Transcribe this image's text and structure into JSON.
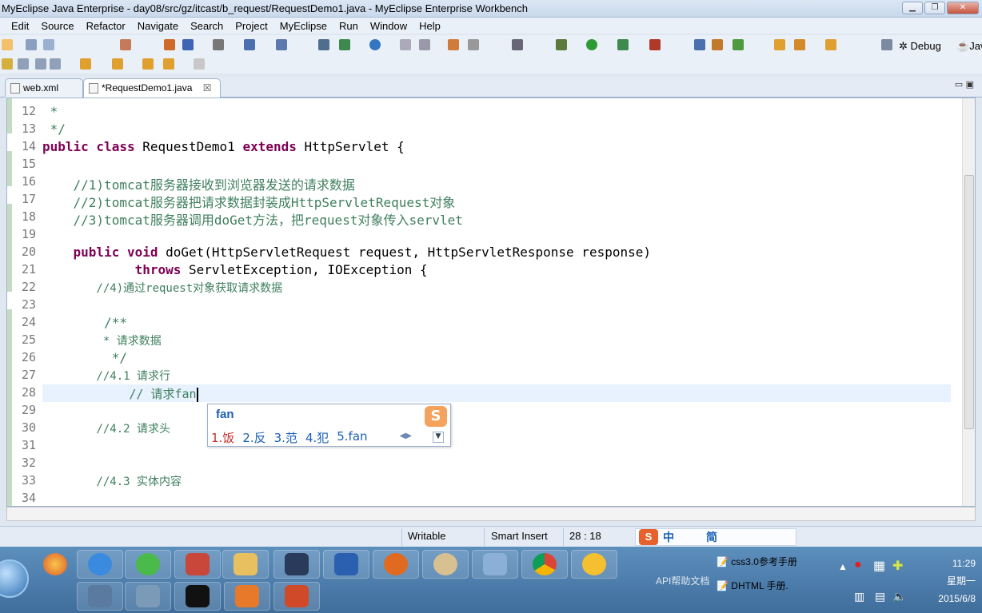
{
  "window": {
    "title": "MyEclipse Java Enterprise - day08/src/gz/itcast/b_request/RequestDemo1.java - MyEclipse Enterprise Workbench"
  },
  "menu": [
    "Edit",
    "Source",
    "Refactor",
    "Navigate",
    "Search",
    "Project",
    "MyEclipse",
    "Run",
    "Window",
    "Help"
  ],
  "perspectives": {
    "debug": "Debug",
    "java": "Jav"
  },
  "tabs": [
    {
      "label": "web.xml",
      "active": false
    },
    {
      "label": "*RequestDemo1.java",
      "active": true,
      "close": "☒"
    }
  ],
  "editor": {
    "lines": [
      {
        "n": "12",
        "text": " *"
      },
      {
        "n": "13",
        "text": " */"
      },
      {
        "n": "14",
        "pre": "",
        "kw1": "public class",
        "mid": " RequestDemo1 ",
        "kw2": "extends",
        "post": " HttpServlet {"
      },
      {
        "n": "15",
        "text": ""
      },
      {
        "n": "16",
        "comment": "    //1)tomcat服务器接收到浏览器发送的请求数据"
      },
      {
        "n": "17",
        "comment": "    //2)tomcat服务器把请求数据封装成HttpServletRequest对象"
      },
      {
        "n": "18",
        "comment": "    //3)tomcat服务器调用doGet方法，把request对象传入servlet"
      },
      {
        "n": "19",
        "text": ""
      },
      {
        "n": "20",
        "kw1": "    public void",
        "post": " doGet(HttpServletRequest request, HttpServletResponse response)"
      },
      {
        "n": "21",
        "kw1": "            throws",
        "post": " ServletException, IOException {"
      },
      {
        "n": "22",
        "comment": "        //4)通过request对象获取请求数据"
      },
      {
        "n": "23",
        "text": ""
      },
      {
        "n": "24",
        "comment": "        /**"
      },
      {
        "n": "25",
        "comment": "         * 请求数据"
      },
      {
        "n": "26",
        "comment": "         */"
      },
      {
        "n": "27",
        "comment": "        //4.1 请求行"
      },
      {
        "n": "28",
        "comment": "            // 请求fan"
      },
      {
        "n": "29",
        "text": ""
      },
      {
        "n": "30",
        "comment": "        //4.2 请求头"
      },
      {
        "n": "31",
        "text": ""
      },
      {
        "n": "32",
        "text": ""
      },
      {
        "n": "33",
        "comment": "        //4.3 实体内容"
      },
      {
        "n": "34",
        "text": ""
      }
    ]
  },
  "ime": {
    "composition": "fan",
    "candidates": [
      "1.饭",
      "2.反",
      "3.范",
      "4.犯",
      "5.fan"
    ],
    "logo": "S"
  },
  "status": {
    "writable": "Writable",
    "insert_mode": "Smart Insert",
    "position": "28 : 18",
    "ime_zh": "中",
    "ime_jian": "简"
  },
  "taskbar": {
    "tray_item1": "css3.0参考手册",
    "tray_item2": "DHTML 手册.",
    "tray_item3": "API帮助文档",
    "time": "11:29",
    "weekday": "星期一",
    "date": "2015/6/8"
  }
}
